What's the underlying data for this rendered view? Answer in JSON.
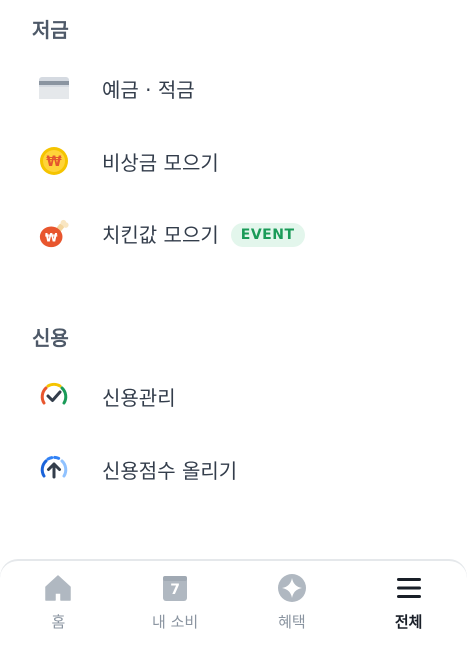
{
  "savings": {
    "title": "저금",
    "items": [
      {
        "label": "예금 · 적금",
        "icon": "bankbook-icon"
      },
      {
        "label": "비상금 모으기",
        "icon": "won-coin-icon"
      },
      {
        "label": "치킨값 모으기",
        "icon": "chicken-icon",
        "badge": "EVENT"
      }
    ]
  },
  "credit": {
    "title": "신용",
    "items": [
      {
        "label": "신용관리",
        "icon": "credit-gauge-check-icon"
      },
      {
        "label": "신용점수 올리기",
        "icon": "credit-gauge-up-icon"
      }
    ]
  },
  "tabbar": {
    "tabs": [
      {
        "label": "홈",
        "icon": "home-icon",
        "active": false
      },
      {
        "label": "내 소비",
        "icon": "calendar-icon",
        "calendar_day": "7",
        "active": false
      },
      {
        "label": "혜택",
        "icon": "sparkle-icon",
        "active": false
      },
      {
        "label": "전체",
        "icon": "menu-icon",
        "active": true
      }
    ]
  },
  "colors": {
    "badge_bg": "#e3f6ec",
    "badge_text": "#1a9b58",
    "coin": "#f5c400",
    "chicken": "#e8562e",
    "gauge_blue": "#3182f6"
  }
}
